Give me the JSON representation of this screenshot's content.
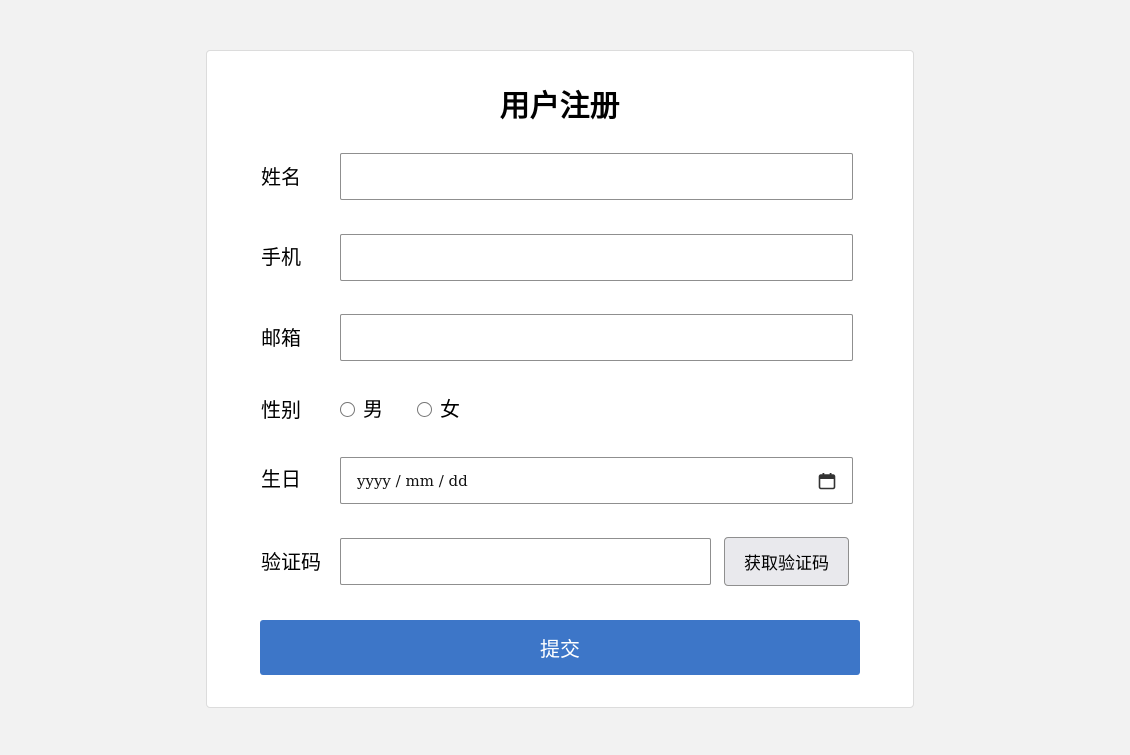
{
  "form": {
    "title": "用户注册",
    "fields": {
      "name": {
        "label": "姓名",
        "value": ""
      },
      "phone": {
        "label": "手机",
        "value": ""
      },
      "email": {
        "label": "邮箱",
        "value": ""
      },
      "gender": {
        "label": "性别",
        "options": [
          "男",
          "女"
        ],
        "selected": null
      },
      "birthday": {
        "label": "生日",
        "placeholder": "yyyy / mm / dd",
        "icon": "calendar-icon"
      },
      "captcha": {
        "label": "验证码",
        "value": "",
        "button_label": "获取验证码"
      }
    },
    "submit_label": "提交"
  },
  "colors": {
    "page_background": "#f2f2f2",
    "card_background": "#ffffff",
    "primary": "#3d76c8",
    "secondary_button": "#e9e9ed"
  }
}
